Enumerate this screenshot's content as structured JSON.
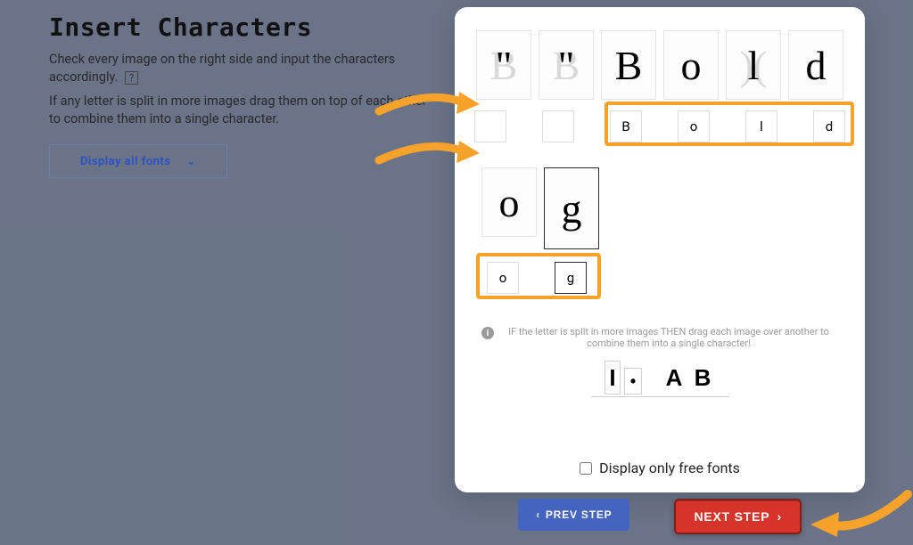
{
  "left": {
    "title": "Insert Characters",
    "subtext1": "Check every image on the right side and input the characters accordingly.",
    "help_label": "?",
    "subtext2": "If any letter is split in more images drag them on top of each other to combine them into a single character.",
    "dropdown_label": "Display all fonts"
  },
  "modal": {
    "row1_tiles": [
      {
        "fore": "\"",
        "ghost": "B"
      },
      {
        "fore": "\"",
        "ghost": "B"
      },
      {
        "fore": "B",
        "ghost": ""
      },
      {
        "fore": "o",
        "ghost": ""
      },
      {
        "fore": "l",
        "ghost": ")("
      },
      {
        "fore": "d",
        "ghost": ""
      }
    ],
    "row1_inputs": [
      "",
      "",
      "B",
      "o",
      "l",
      "d"
    ],
    "row2_tiles": [
      {
        "fore": "o",
        "ghost": ""
      },
      {
        "fore": "g",
        "ghost": "",
        "selected": true
      }
    ],
    "row2_inputs": [
      {
        "value": "o",
        "selected": false
      },
      {
        "value": "g",
        "selected": true
      }
    ],
    "hint_text": "IF the letter is split in more images THEN drag each image over another to combine them into a single character!",
    "example_letters": [
      "I",
      "·",
      "A",
      "B"
    ],
    "checkbox_label": "Display only free fonts"
  },
  "nav": {
    "prev_label": "PREV STEP",
    "next_label": "NEXT STEP"
  },
  "colors": {
    "highlight": "#f6a22b",
    "primary_blue": "#4364bf",
    "danger_red": "#d6332a"
  }
}
